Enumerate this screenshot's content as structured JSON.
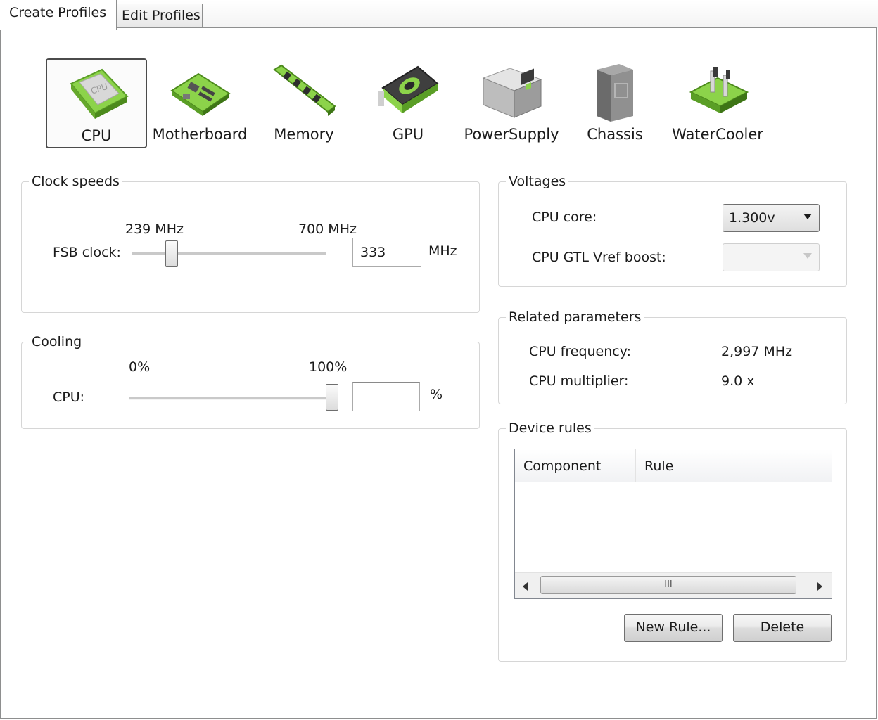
{
  "tabs": [
    {
      "label": "Create Profiles",
      "active": true
    },
    {
      "label": "Edit Profiles",
      "active": false
    }
  ],
  "devices": [
    {
      "label": "CPU",
      "icon": "cpu-chip-icon",
      "selected": true
    },
    {
      "label": "Motherboard",
      "icon": "motherboard-icon",
      "selected": false
    },
    {
      "label": "Memory",
      "icon": "memory-stick-icon",
      "selected": false
    },
    {
      "label": "GPU",
      "icon": "graphics-card-icon",
      "selected": false
    },
    {
      "label": "PowerSupply",
      "icon": "power-supply-icon",
      "selected": false
    },
    {
      "label": "Chassis",
      "icon": "chassis-icon",
      "selected": false
    },
    {
      "label": "WaterCooler",
      "icon": "water-cooler-icon",
      "selected": false
    }
  ],
  "cpu_chip_text": "CPU",
  "clock_speeds": {
    "title": "Clock speeds",
    "min_label": "239 MHz",
    "max_label": "700 MHz",
    "fsb_label": "FSB clock:",
    "fsb_value": "333",
    "unit": "MHz",
    "fsb_min": 239,
    "fsb_max": 700,
    "fsb_current": 333
  },
  "cooling": {
    "title": "Cooling",
    "min_label": "0%",
    "max_label": "100%",
    "cpu_label": "CPU:",
    "cpu_value": "",
    "unit": "%",
    "cpu_fraction": 1.0
  },
  "voltages": {
    "title": "Voltages",
    "cpu_core_label": "CPU core:",
    "cpu_core_value": "1.300v",
    "gtl_label": "CPU GTL Vref boost:",
    "gtl_value": ""
  },
  "related": {
    "title": "Related parameters",
    "freq_label": "CPU frequency:",
    "freq_value": "2,997 MHz",
    "mult_label": "CPU multiplier:",
    "mult_value": "9.0 x"
  },
  "device_rules": {
    "title": "Device rules",
    "columns": [
      "Component",
      "Rule"
    ],
    "rows": [],
    "scroll_grip": "III",
    "new_rule_label": "New Rule...",
    "delete_label": "Delete"
  },
  "colors": {
    "accent_green": "#7ac943",
    "frame_border": "#8e8f8f"
  }
}
